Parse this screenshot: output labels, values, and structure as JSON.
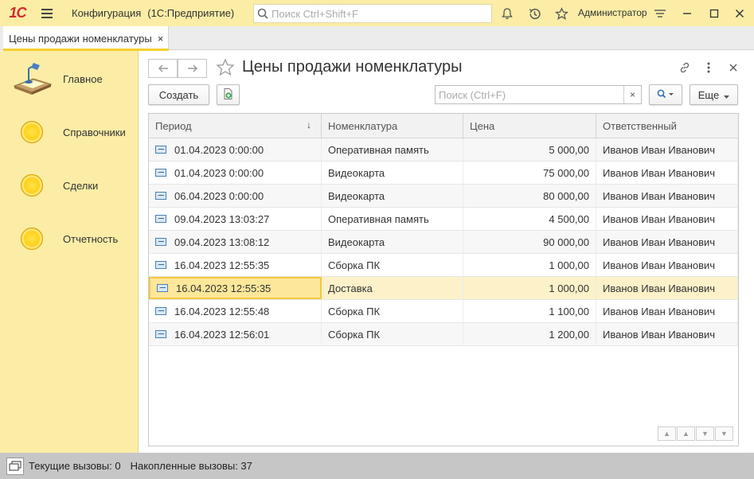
{
  "titlebar": {
    "logo": "1С",
    "app_name": "Конфигурация",
    "app_mode": "(1С:Предприятие)",
    "search_placeholder": "Поиск Ctrl+Shift+F",
    "user": "Администратор",
    "icons": [
      "bell-icon",
      "history-icon",
      "star-icon",
      "settings-icon",
      "minimize-icon",
      "maximize-icon",
      "close-icon"
    ]
  },
  "open_tab": {
    "label": "Цены продажи номенклатуры",
    "close": "×"
  },
  "sidebar": {
    "items": [
      {
        "label": "Главное",
        "icon": "desk-lamp-icon"
      },
      {
        "label": "Справочники",
        "icon": "coin-icon"
      },
      {
        "label": "Сделки",
        "icon": "coin-icon"
      },
      {
        "label": "Отчетность",
        "icon": "coin-icon"
      }
    ]
  },
  "form": {
    "title": "Цены продажи номенклатуры",
    "create_label": "Создать",
    "search_placeholder": "Поиск (Ctrl+F)",
    "search_clear": "×",
    "more_label": "Еще"
  },
  "table": {
    "columns": [
      "Период",
      "Номенклатура",
      "Цена",
      "Ответственный"
    ],
    "sort_indicator": "↓",
    "rows": [
      {
        "period": "01.04.2023 0:00:00",
        "item": "Оперативная память",
        "price": "5 000,00",
        "responsible": "Иванов Иван Иванович"
      },
      {
        "period": "01.04.2023 0:00:00",
        "item": "Видеокарта",
        "price": "75 000,00",
        "responsible": "Иванов Иван Иванович"
      },
      {
        "period": "06.04.2023 0:00:00",
        "item": "Видеокарта",
        "price": "80 000,00",
        "responsible": "Иванов Иван Иванович"
      },
      {
        "period": "09.04.2023 13:03:27",
        "item": "Оперативная память",
        "price": "4 500,00",
        "responsible": "Иванов Иван Иванович"
      },
      {
        "period": "09.04.2023 13:08:12",
        "item": "Видеокарта",
        "price": "90 000,00",
        "responsible": "Иванов Иван Иванович"
      },
      {
        "period": "16.04.2023 12:55:35",
        "item": "Сборка ПК",
        "price": "1 000,00",
        "responsible": "Иванов Иван Иванович"
      },
      {
        "period": "16.04.2023 12:55:35",
        "item": "Доставка",
        "price": "1 000,00",
        "responsible": "Иванов Иван Иванович"
      },
      {
        "period": "16.04.2023 12:55:48",
        "item": "Сборка ПК",
        "price": "1 100,00",
        "responsible": "Иванов Иван Иванович"
      },
      {
        "period": "16.04.2023 12:56:01",
        "item": "Сборка ПК",
        "price": "1 200,00",
        "responsible": "Иванов Иван Иванович"
      }
    ],
    "selected_row": 6
  },
  "statusbar": {
    "current_calls": "Текущие вызовы: 0",
    "accumulated_calls": "Накопленные вызовы: 37"
  },
  "colors": {
    "accent_yellow": "#fbeda6",
    "tab_underline": "#f5cf2e",
    "selection": "#fcf1c9",
    "logo_red": "#d4282e"
  }
}
